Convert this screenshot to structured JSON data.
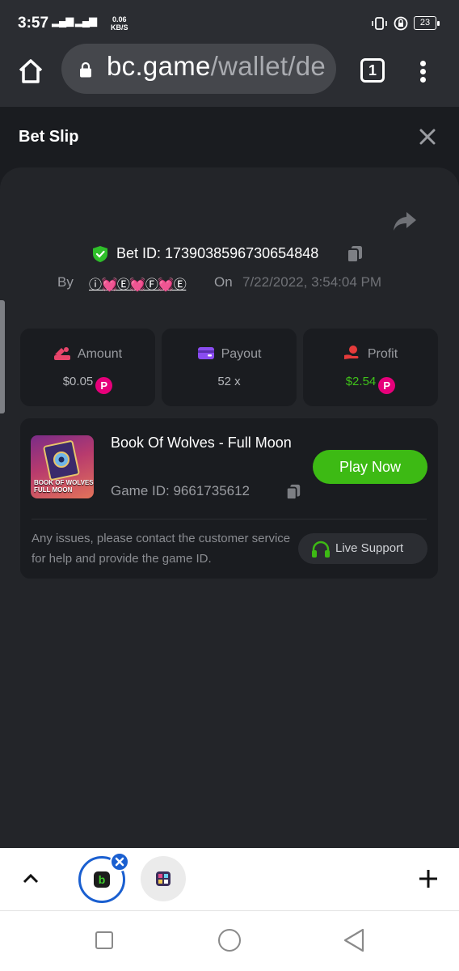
{
  "status_bar": {
    "time": "3:57",
    "net_speed_value": "0.06",
    "net_speed_unit": "KB/S",
    "battery": "23"
  },
  "browser": {
    "url_host": "bc.game",
    "url_path": "/wallet/de",
    "tab_count": "1"
  },
  "sheet": {
    "title": "Bet Slip"
  },
  "bet": {
    "id_label": "Bet ID: 1739038596730654848",
    "by_label": "By",
    "user": "ⓘ💓Ⓔ💓Ⓕ💓Ⓔ",
    "on_label": "On",
    "date": "7/22/2022, 3:54:04 PM"
  },
  "stats": {
    "amount": {
      "label": "Amount",
      "value": "$0.05"
    },
    "payout": {
      "label": "Payout",
      "value": "52 x"
    },
    "profit": {
      "label": "Profit",
      "value": "$2.54"
    }
  },
  "game": {
    "name": "Book Of Wolves - Full Moon",
    "thumb_label": "BOOK OF WOLVES FULL MOON",
    "id_label": "Game ID: 9661735612",
    "play_label": "Play Now",
    "support_text": "Any issues, please contact the customer service for help and provide the game ID.",
    "live_support_label": "Live Support"
  },
  "colors": {
    "accent_green": "#3dba14",
    "coin_pink": "#e6007a",
    "profit_green": "#3fc21a"
  }
}
